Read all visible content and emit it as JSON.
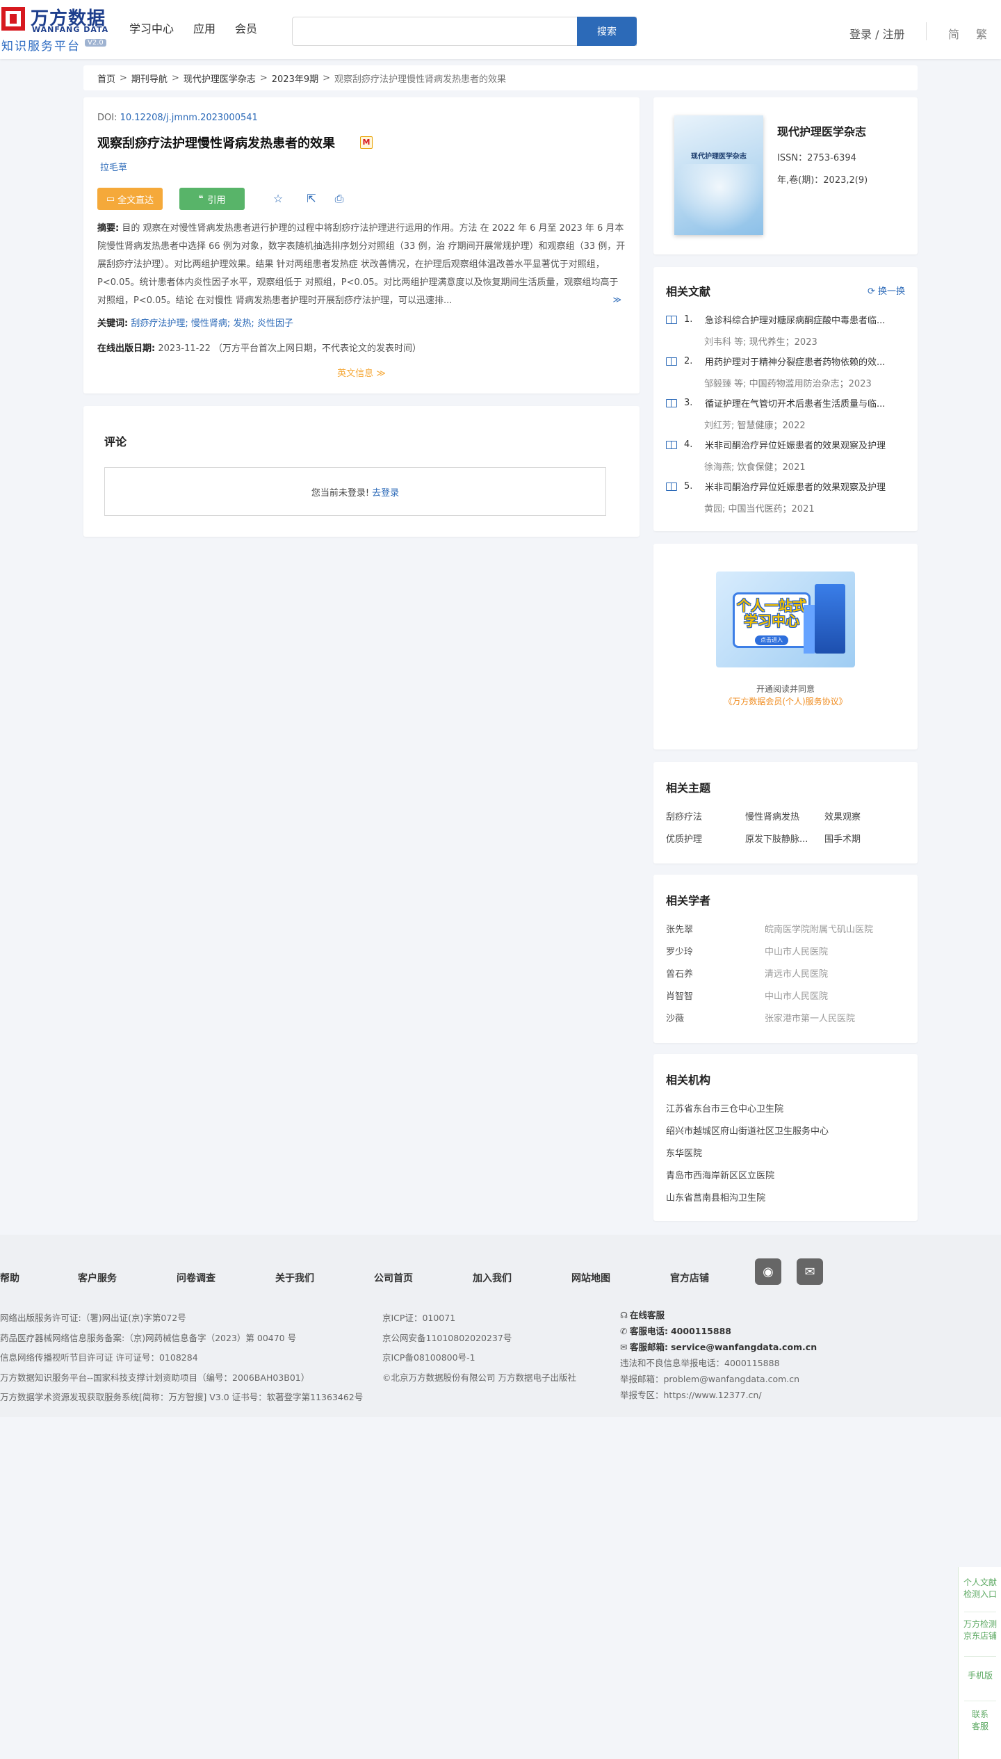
{
  "header": {
    "logo_cn": "万方数据",
    "logo_en": "WANFANG DATA",
    "logo_sub": "知识服务平台",
    "logo_version": "V2.0",
    "nav": [
      "学习中心",
      "应用",
      "会员"
    ],
    "search_placeholder": "",
    "search_button": "搜索",
    "login": "登录 / 注册",
    "lang_simplified": "简",
    "lang_traditional": "繁"
  },
  "breadcrumb": {
    "items": [
      "首页",
      "期刊导航",
      "现代护理医学杂志",
      "2023年9期"
    ],
    "current": "观察刮痧疗法护理慢性肾病发热患者的效果",
    "separator": ">"
  },
  "article": {
    "doi_label": "DOI:",
    "doi": "10.12208/j.jmnm.2023000541",
    "title": "观察刮痧疗法护理慢性肾病发热患者的效果",
    "badge": "M",
    "author": "拉毛草",
    "full_text_button": "全文直达",
    "cite_button": "引用",
    "abstract_label": "摘要:",
    "abstract": "目的 观察在对慢性肾病发热患者进行护理的过程中将刮痧疗法护理进行运用的作用。方法 在 2022 年 6 月至 2023 年 6 月本院慢性肾病发热患者中选择 66 例为对象，数字表随机抽选排序划分对照组（33 例，治 疗期间开展常规护理）和观察组（33 例，开展刮痧疗法护理）。对比两组护理效果。结果 针对两组患者发热症 状改善情况，在护理后观察组体温改善水平显著优于对照组，P<0.05。统计患者体内炎性因子水平，观察组低于 对照组，P<0.05。对比两组护理满意度以及恢复期间生活质量，观察组均高于对照组，P<0.05。结论 在对慢性 肾病发热患者护理时开展刮痧疗法护理，可以迅速排...",
    "abstract_more": "≫",
    "keywords_label": "关键词:",
    "keywords": [
      "刮痧疗法护理;",
      "慢性肾病;",
      "发热;",
      "炎性因子"
    ],
    "pubdate_label": "在线出版日期:",
    "pubdate": "2023-11-22 （万方平台首次上网日期，不代表论文的发表时间）",
    "english_info": "英文信息 ≫"
  },
  "comments": {
    "title": "评论",
    "not_logged": "您当前未登录!",
    "go_login": "去登录"
  },
  "journal": {
    "cover_title": "现代护理医学杂志",
    "name": "现代护理医学杂志",
    "issn": "ISSN：2753-6394",
    "volume": "年,卷(期)：2023,2(9)"
  },
  "related_docs": {
    "title": "相关文献",
    "swap": "换一换",
    "items": [
      {
        "num": "1.",
        "title": "急诊科综合护理对糖尿病酮症酸中毒患者临...",
        "authors": "刘韦科  等;",
        "source": "现代养生；2023"
      },
      {
        "num": "2.",
        "title": "用药护理对于精神分裂症患者药物依赖的效...",
        "authors": "邹毅臻  等;",
        "source": "中国药物滥用防治杂志；2023"
      },
      {
        "num": "3.",
        "title": "循证护理在气管切开术后患者生活质量与临...",
        "authors": "刘红芳;",
        "source": "智慧健康；2022"
      },
      {
        "num": "4.",
        "title": "米非司酮治疗异位妊娠患者的效果观察及护理",
        "authors": "徐海燕;",
        "source": "饮食保健；2021"
      },
      {
        "num": "5.",
        "title": "米非司酮治疗异位妊娠患者的效果观察及护理",
        "authors": "黄园;",
        "source": "中国当代医药；2021"
      }
    ]
  },
  "ad": {
    "headline": "个人一站式学习中心",
    "enter": "点击进入",
    "text1": "开通阅读并同意",
    "text2": "《万方数据会员(个人)服务协议》"
  },
  "topics": {
    "title": "相关主题",
    "items": [
      "刮痧疗法",
      "慢性肾病发热",
      "效果观察",
      "优质护理",
      "原发下肢静脉...",
      "围手术期"
    ]
  },
  "scholars": {
    "title": "相关学者",
    "items": [
      {
        "name": "张先翠",
        "org": "皖南医学院附属弋矶山医院"
      },
      {
        "name": "罗少玲",
        "org": "中山市人民医院"
      },
      {
        "name": "曾石养",
        "org": "清远市人民医院"
      },
      {
        "name": "肖智智",
        "org": "中山市人民医院"
      },
      {
        "name": "沙薇",
        "org": "张家港市第一人民医院"
      }
    ]
  },
  "institutions": {
    "title": "相关机构",
    "items": [
      "江苏省东台市三仓中心卫生院",
      "绍兴市越城区府山街道社区卫生服务中心",
      "东华医院",
      "青岛市西海岸新区区立医院",
      "山东省莒南县相沟卫生院"
    ]
  },
  "footer": {
    "links": [
      "帮助",
      "客户服务",
      "问卷调查",
      "关于我们",
      "公司首页",
      "加入我们",
      "网站地图",
      "官方店铺"
    ],
    "col1": [
      "网络出版服务许可证:（署)网出证(京)字第072号",
      "药品医疗器械网络信息服务备案:（京)网药械信息备字（2023）第 00470 号",
      "信息网络传播视听节目许可证 许可证号：0108284",
      "万方数据知识服务平台--国家科技支撑计划资助项目（编号：2006BAH03B01）",
      "万方数据学术资源发现获取服务系统[简称：万方智搜] V3.0 证书号：软著登字第11363462号"
    ],
    "col2": [
      "京ICP证：010071",
      "京公网安备11010802020237号",
      "京ICP备08100800号-1",
      "©北京万方数据股份有限公司 万方数据电子出版社"
    ],
    "col3_online": "在线客服",
    "col3_phone_label": "客服电话:",
    "col3_phone": "4000115888",
    "col3_email_label": "客服邮箱:",
    "col3_email": "service@wanfangdata.com.cn",
    "col3_report_phone": "违法和不良信息举报电话：4000115888",
    "col3_report_email": "举报邮箱：problem@wanfangdata.com.cn",
    "col3_report_site": "举报专区：https://www.12377.cn/"
  },
  "float_bar": {
    "item1": "个人文献检测入口",
    "item2": "万方检测京东店铺",
    "item3": "手机版",
    "item4": "联系客服"
  },
  "colors": {
    "brand_blue": "#2c6ab8",
    "logo_red": "#d7191f",
    "orange": "#f5a93a",
    "green": "#58b469"
  }
}
